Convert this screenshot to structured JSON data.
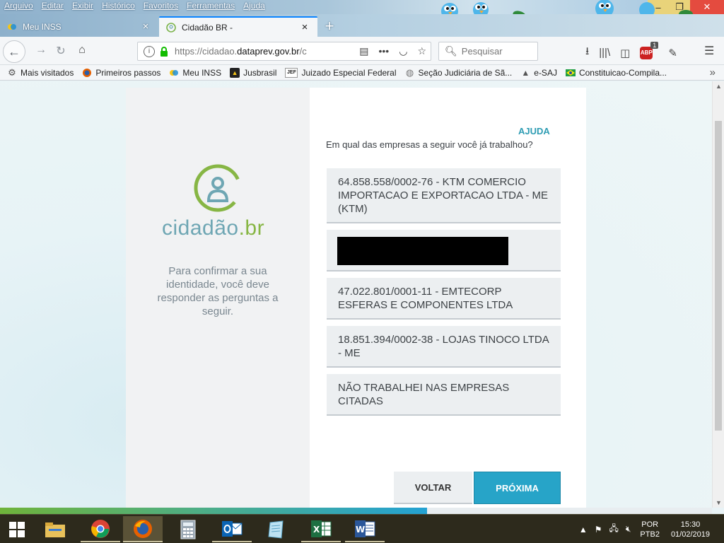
{
  "menu": [
    "Arquivo",
    "Editar",
    "Exibir",
    "Histórico",
    "Favoritos",
    "Ferramentas",
    "Ajuda"
  ],
  "window_controls": {
    "minimize": "–",
    "maximize": "❐",
    "close": "✕"
  },
  "tabs": [
    {
      "title": "Meu INSS",
      "active": false
    },
    {
      "title": "Cidadão BR -",
      "active": true
    }
  ],
  "nav": {
    "url_prefix": "https://cidadao.",
    "url_domain": "dataprev.gov.br",
    "url_suffix": "/c",
    "search_placeholder": "Pesquisar",
    "adblock_count": "1"
  },
  "bookmarks": [
    {
      "label": "Mais visitados",
      "icon": "gear-icon"
    },
    {
      "label": "Primeiros passos",
      "icon": "firefox-icon"
    },
    {
      "label": "Meu INSS",
      "icon": "inss-icon"
    },
    {
      "label": "Jusbrasil",
      "icon": "jusbrasil-icon"
    },
    {
      "label": "Juizado Especial Federal",
      "icon": "jef-icon",
      "icon_text": "JEF"
    },
    {
      "label": "Seção Judiciária de Sã...",
      "icon": "globe-icon"
    },
    {
      "label": "e-SAJ",
      "icon": "esaj-icon"
    },
    {
      "label": "Constituicao-Compila...",
      "icon": "brazil-flag-icon"
    }
  ],
  "page": {
    "logo_text_main": "cidadão",
    "logo_text_accent": ".br",
    "intro": "Para confirmar a sua identidade, você deve responder as perguntas a seguir.",
    "help_link": "AJUDA",
    "question": "Em qual das empresas a seguir você já trabalhou?",
    "options": [
      "64.858.558/0002-76 - KTM COMERCIO IMPORTACAO E EXPORTACAO LTDA - ME (KTM)",
      "",
      "47.022.801/0001-11 - EMTECORP ESFERAS E COMPONENTES LTDA",
      "18.851.394/0002-38 - LOJAS TINOCO LTDA - ME",
      "NÃO TRABALHEI NAS EMPRESAS CITADAS"
    ],
    "back_button": "VOLTAR",
    "next_button": "PRÓXIMA"
  },
  "progress_fraction": 0.6,
  "taskbar": {
    "apps": [
      "file-explorer",
      "chrome",
      "firefox",
      "calculator",
      "outlook",
      "notepad",
      "excel",
      "word"
    ],
    "lang_top": "POR",
    "lang_bottom": "PTB2",
    "time": "15:30",
    "date": "01/02/2019"
  },
  "colors": {
    "accent": "#27a4c8",
    "help": "#2d9cb3",
    "logo_teal": "#6ea6b3",
    "logo_green": "#87b644"
  }
}
